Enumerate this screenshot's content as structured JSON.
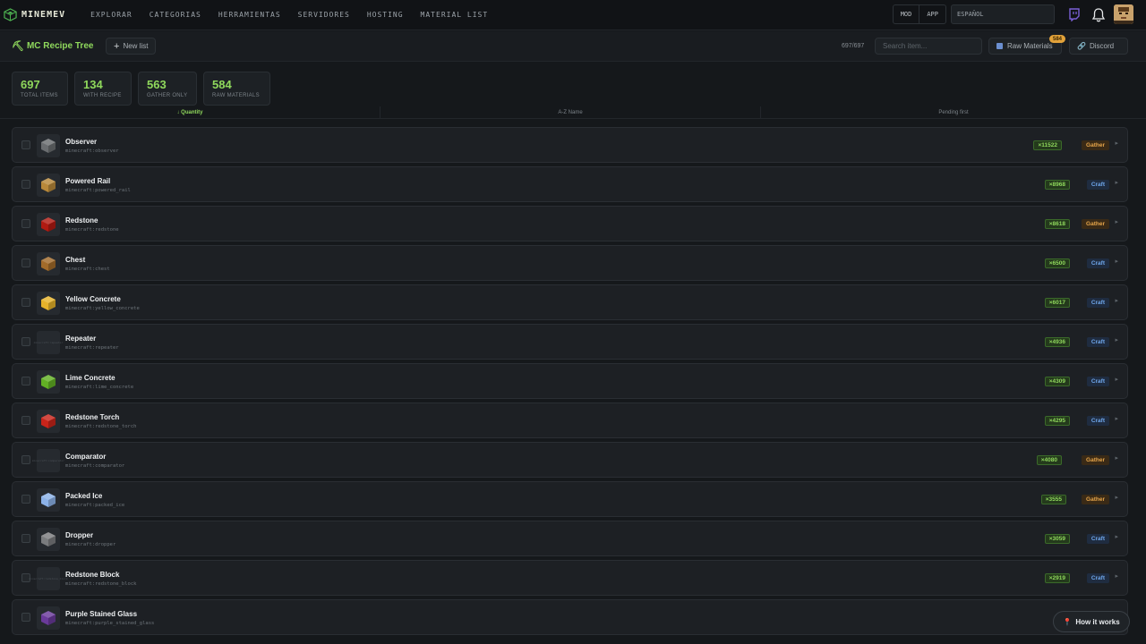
{
  "brand": {
    "name": "MINEMEV"
  },
  "nav": {
    "items": [
      "EXPLORAR",
      "CATEGORIAS",
      "HERRAMIENTAS",
      "SERVIDORES",
      "HOSTING",
      "MATERIAL LIST"
    ],
    "pills": [
      "MOD",
      "APP"
    ],
    "language": "ESPAÑOL"
  },
  "toolbar": {
    "title": "MC Recipe Tree",
    "new_list": "New list",
    "count": "697/697",
    "search_placeholder": "Search item...",
    "raw_materials": "Raw Materials",
    "raw_badge": "584",
    "discord": "Discord"
  },
  "stats": [
    {
      "value": "697",
      "label": "TOTAL ITEMS"
    },
    {
      "value": "134",
      "label": "WITH RECIPE"
    },
    {
      "value": "563",
      "label": "GATHER ONLY"
    },
    {
      "value": "584",
      "label": "RAW MATERIALS"
    }
  ],
  "sort": [
    "↓ Quantity",
    "A-Z Name",
    "Pending first"
  ],
  "items": [
    {
      "name": "Observer",
      "id": "minecraft:observer",
      "qty": "×11522",
      "type": "Gather",
      "icon": "observer-icon",
      "color": "#6a6d70"
    },
    {
      "name": "Powered Rail",
      "id": "minecraft:powered_rail",
      "qty": "×8968",
      "type": "Craft",
      "icon": "powered-rail-icon",
      "color": "#b8883a"
    },
    {
      "name": "Redstone",
      "id": "minecraft:redstone",
      "qty": "×8618",
      "type": "Gather",
      "icon": "redstone-icon",
      "color": "#b01a12"
    },
    {
      "name": "Chest",
      "id": "minecraft:chest",
      "qty": "×6500",
      "type": "Craft",
      "icon": "chest-icon",
      "color": "#a26b2a"
    },
    {
      "name": "Yellow Concrete",
      "id": "minecraft:yellow_concrete",
      "qty": "×6017",
      "type": "Craft",
      "icon": "yellow-concrete-icon",
      "color": "#e6b22a"
    },
    {
      "name": "Repeater",
      "id": "minecraft:repeater",
      "qty": "×4936",
      "type": "Craft",
      "icon": "repeater-icon",
      "color": ""
    },
    {
      "name": "Lime Concrete",
      "id": "minecraft:lime_concrete",
      "qty": "×4309",
      "type": "Craft",
      "icon": "lime-concrete-icon",
      "color": "#62b024"
    },
    {
      "name": "Redstone Torch",
      "id": "minecraft:redstone_torch",
      "qty": "×4295",
      "type": "Craft",
      "icon": "redstone-torch-icon",
      "color": "#c8241a"
    },
    {
      "name": "Comparator",
      "id": "minecraft:comparator",
      "qty": "×4080",
      "type": "Gather",
      "icon": "comparator-icon",
      "color": ""
    },
    {
      "name": "Packed Ice",
      "id": "minecraft:packed_ice",
      "qty": "×3555",
      "type": "Gather",
      "icon": "packed-ice-icon",
      "color": "#8cb2e8"
    },
    {
      "name": "Dropper",
      "id": "minecraft:dropper",
      "qty": "×3059",
      "type": "Craft",
      "icon": "dropper-icon",
      "color": "#7a7c7e"
    },
    {
      "name": "Redstone Block",
      "id": "minecraft:redstone_block",
      "qty": "×2919",
      "type": "Craft",
      "icon": "redstone-block-icon",
      "color": ""
    },
    {
      "name": "Purple Stained Glass",
      "id": "minecraft:purple_stained_glass",
      "qty": "",
      "type": "",
      "icon": "purple-glass-icon",
      "color": "#6a3a9a"
    }
  ],
  "help": {
    "label": "How it works"
  },
  "colors": {
    "accent": "#8fd85c",
    "craft": "#6fa7ec",
    "gather": "#e6a54a"
  }
}
